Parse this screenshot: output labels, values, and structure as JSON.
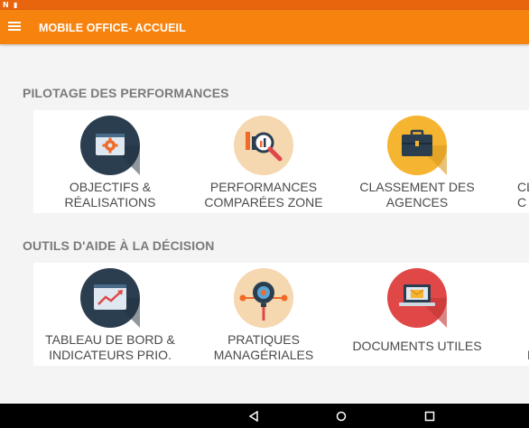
{
  "status_bar": {
    "left_icons": [
      "N",
      "▮"
    ]
  },
  "app_bar": {
    "title": "MOBILE OFFICE- ACCUEIL",
    "menu_icon": "hamburger-icon"
  },
  "sections": [
    {
      "title": "PILOTAGE DES PERFORMANCES",
      "tiles": [
        {
          "label": "OBJECTIFS &\nRÉALISATIONS",
          "icon": "settings-screen-icon"
        },
        {
          "label": "PERFORMANCES\nCOMPARÉES ZONE",
          "icon": "magnifier-chart-icon"
        },
        {
          "label": "CLASSEMENT DES\nAGENCES",
          "icon": "briefcase-icon"
        },
        {
          "label": "CL\nC",
          "icon": "partial-tile"
        }
      ]
    },
    {
      "title": "OUTILS D'AIDE À LA DÉCISION",
      "tiles": [
        {
          "label": "TABLEAU DE BORD &\nINDICATEURS PRIO.",
          "icon": "trend-screen-icon"
        },
        {
          "label": "PRATIQUES\nMANAGÉRIALES",
          "icon": "lightbulb-network-icon"
        },
        {
          "label": "DOCUMENTS UTILES",
          "icon": "laptop-mail-icon"
        },
        {
          "label": "N",
          "icon": "partial-tile"
        }
      ]
    }
  ],
  "colors": {
    "status_bar": "#e8650e",
    "app_bar": "#f7830f",
    "navy": "#2b3e50",
    "peach": "#f5d7b0",
    "yellow": "#f6b530",
    "red": "#e04848"
  }
}
